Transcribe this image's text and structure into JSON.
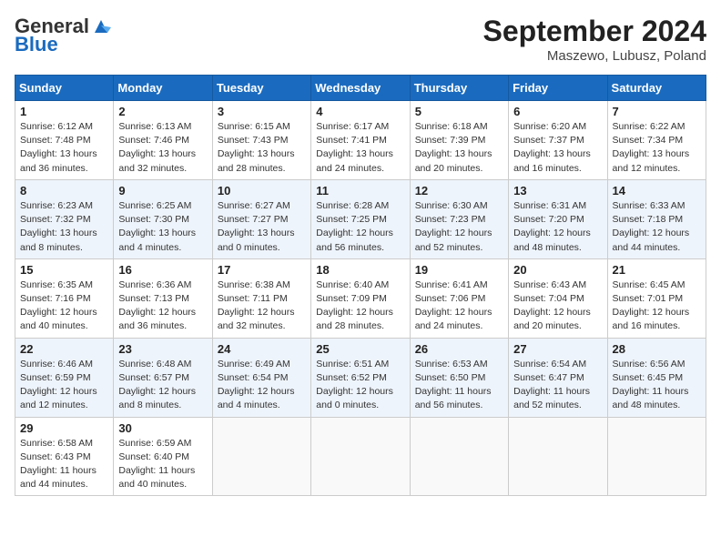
{
  "header": {
    "logo_general": "General",
    "logo_blue": "Blue",
    "month_year": "September 2024",
    "location": "Maszewo, Lubusz, Poland"
  },
  "weekdays": [
    "Sunday",
    "Monday",
    "Tuesday",
    "Wednesday",
    "Thursday",
    "Friday",
    "Saturday"
  ],
  "weeks": [
    [
      {
        "day": "1",
        "info": "Sunrise: 6:12 AM\nSunset: 7:48 PM\nDaylight: 13 hours\nand 36 minutes."
      },
      {
        "day": "2",
        "info": "Sunrise: 6:13 AM\nSunset: 7:46 PM\nDaylight: 13 hours\nand 32 minutes."
      },
      {
        "day": "3",
        "info": "Sunrise: 6:15 AM\nSunset: 7:43 PM\nDaylight: 13 hours\nand 28 minutes."
      },
      {
        "day": "4",
        "info": "Sunrise: 6:17 AM\nSunset: 7:41 PM\nDaylight: 13 hours\nand 24 minutes."
      },
      {
        "day": "5",
        "info": "Sunrise: 6:18 AM\nSunset: 7:39 PM\nDaylight: 13 hours\nand 20 minutes."
      },
      {
        "day": "6",
        "info": "Sunrise: 6:20 AM\nSunset: 7:37 PM\nDaylight: 13 hours\nand 16 minutes."
      },
      {
        "day": "7",
        "info": "Sunrise: 6:22 AM\nSunset: 7:34 PM\nDaylight: 13 hours\nand 12 minutes."
      }
    ],
    [
      {
        "day": "8",
        "info": "Sunrise: 6:23 AM\nSunset: 7:32 PM\nDaylight: 13 hours\nand 8 minutes."
      },
      {
        "day": "9",
        "info": "Sunrise: 6:25 AM\nSunset: 7:30 PM\nDaylight: 13 hours\nand 4 minutes."
      },
      {
        "day": "10",
        "info": "Sunrise: 6:27 AM\nSunset: 7:27 PM\nDaylight: 13 hours\nand 0 minutes."
      },
      {
        "day": "11",
        "info": "Sunrise: 6:28 AM\nSunset: 7:25 PM\nDaylight: 12 hours\nand 56 minutes."
      },
      {
        "day": "12",
        "info": "Sunrise: 6:30 AM\nSunset: 7:23 PM\nDaylight: 12 hours\nand 52 minutes."
      },
      {
        "day": "13",
        "info": "Sunrise: 6:31 AM\nSunset: 7:20 PM\nDaylight: 12 hours\nand 48 minutes."
      },
      {
        "day": "14",
        "info": "Sunrise: 6:33 AM\nSunset: 7:18 PM\nDaylight: 12 hours\nand 44 minutes."
      }
    ],
    [
      {
        "day": "15",
        "info": "Sunrise: 6:35 AM\nSunset: 7:16 PM\nDaylight: 12 hours\nand 40 minutes."
      },
      {
        "day": "16",
        "info": "Sunrise: 6:36 AM\nSunset: 7:13 PM\nDaylight: 12 hours\nand 36 minutes."
      },
      {
        "day": "17",
        "info": "Sunrise: 6:38 AM\nSunset: 7:11 PM\nDaylight: 12 hours\nand 32 minutes."
      },
      {
        "day": "18",
        "info": "Sunrise: 6:40 AM\nSunset: 7:09 PM\nDaylight: 12 hours\nand 28 minutes."
      },
      {
        "day": "19",
        "info": "Sunrise: 6:41 AM\nSunset: 7:06 PM\nDaylight: 12 hours\nand 24 minutes."
      },
      {
        "day": "20",
        "info": "Sunrise: 6:43 AM\nSunset: 7:04 PM\nDaylight: 12 hours\nand 20 minutes."
      },
      {
        "day": "21",
        "info": "Sunrise: 6:45 AM\nSunset: 7:01 PM\nDaylight: 12 hours\nand 16 minutes."
      }
    ],
    [
      {
        "day": "22",
        "info": "Sunrise: 6:46 AM\nSunset: 6:59 PM\nDaylight: 12 hours\nand 12 minutes."
      },
      {
        "day": "23",
        "info": "Sunrise: 6:48 AM\nSunset: 6:57 PM\nDaylight: 12 hours\nand 8 minutes."
      },
      {
        "day": "24",
        "info": "Sunrise: 6:49 AM\nSunset: 6:54 PM\nDaylight: 12 hours\nand 4 minutes."
      },
      {
        "day": "25",
        "info": "Sunrise: 6:51 AM\nSunset: 6:52 PM\nDaylight: 12 hours\nand 0 minutes."
      },
      {
        "day": "26",
        "info": "Sunrise: 6:53 AM\nSunset: 6:50 PM\nDaylight: 11 hours\nand 56 minutes."
      },
      {
        "day": "27",
        "info": "Sunrise: 6:54 AM\nSunset: 6:47 PM\nDaylight: 11 hours\nand 52 minutes."
      },
      {
        "day": "28",
        "info": "Sunrise: 6:56 AM\nSunset: 6:45 PM\nDaylight: 11 hours\nand 48 minutes."
      }
    ],
    [
      {
        "day": "29",
        "info": "Sunrise: 6:58 AM\nSunset: 6:43 PM\nDaylight: 11 hours\nand 44 minutes."
      },
      {
        "day": "30",
        "info": "Sunrise: 6:59 AM\nSunset: 6:40 PM\nDaylight: 11 hours\nand 40 minutes."
      },
      {
        "day": "",
        "info": ""
      },
      {
        "day": "",
        "info": ""
      },
      {
        "day": "",
        "info": ""
      },
      {
        "day": "",
        "info": ""
      },
      {
        "day": "",
        "info": ""
      }
    ]
  ]
}
